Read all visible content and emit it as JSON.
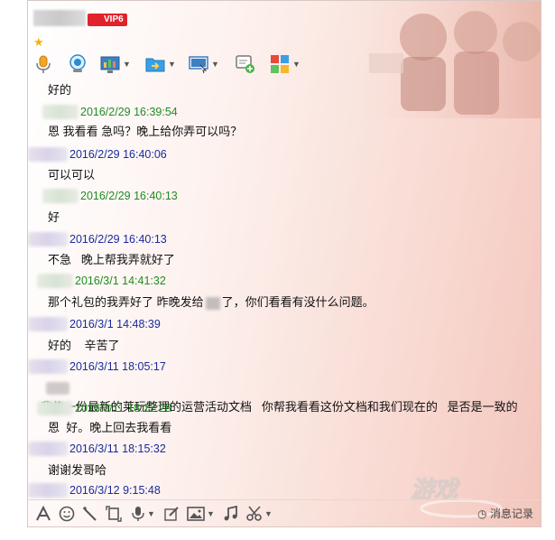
{
  "header": {
    "vip_label": "VIP6",
    "toolbar": [
      {
        "name": "voice-call-icon"
      },
      {
        "name": "video-call-icon"
      },
      {
        "name": "remote-assist-icon"
      },
      {
        "name": "send-file-icon"
      },
      {
        "name": "screen-share-icon"
      },
      {
        "name": "create-discussion-icon"
      },
      {
        "name": "apps-icon"
      }
    ]
  },
  "messages": [
    {
      "kind": "text",
      "text": "好的"
    },
    {
      "kind": "meta",
      "style": "green",
      "time": "2016/2/29 16:39:54"
    },
    {
      "kind": "text",
      "text": "恩 我看看 急吗？晚上给你弄可以吗？"
    },
    {
      "kind": "meta",
      "style": "blue",
      "time": "2016/2/29 16:40:06"
    },
    {
      "kind": "text",
      "text": "可以可以"
    },
    {
      "kind": "meta",
      "style": "green",
      "time": "2016/2/29 16:40:13"
    },
    {
      "kind": "text",
      "text": "好"
    },
    {
      "kind": "meta",
      "style": "blue",
      "time": "2016/2/29 16:40:13"
    },
    {
      "kind": "text",
      "text": "不急   晚上帮我弄就好了"
    },
    {
      "kind": "meta",
      "style": "green",
      "time": "2016/3/1 14:41:32"
    },
    {
      "kind": "text",
      "text_before": "那个礼包的我弄好了 昨晚发给",
      "text_after": "了，你们看看有没什么问题。"
    },
    {
      "kind": "meta",
      "style": "blue",
      "time": "2016/3/1 14:48:39"
    },
    {
      "kind": "text",
      "text": "好的    辛苦了"
    },
    {
      "kind": "meta",
      "style": "blue",
      "time": "2016/3/11 18:05:17"
    },
    {
      "kind": "text",
      "text": "我传一份最新的莱玩整理的运营活动文档   你帮我看看这份文档和我们现在的   是否是一致的"
    },
    {
      "kind": "meta",
      "style": "green",
      "time": "2016/3/11 18:12:28"
    },
    {
      "kind": "text",
      "text": "恩  好。晚上回去我看看"
    },
    {
      "kind": "meta",
      "style": "blue",
      "time": "2016/3/11 18:15:32"
    },
    {
      "kind": "text",
      "text": "谢谢发哥哈"
    },
    {
      "kind": "meta",
      "style": "blue",
      "time": "2016/3/12 9:15:48"
    }
  ],
  "bottom_bar": {
    "history_label": "消息记录"
  }
}
